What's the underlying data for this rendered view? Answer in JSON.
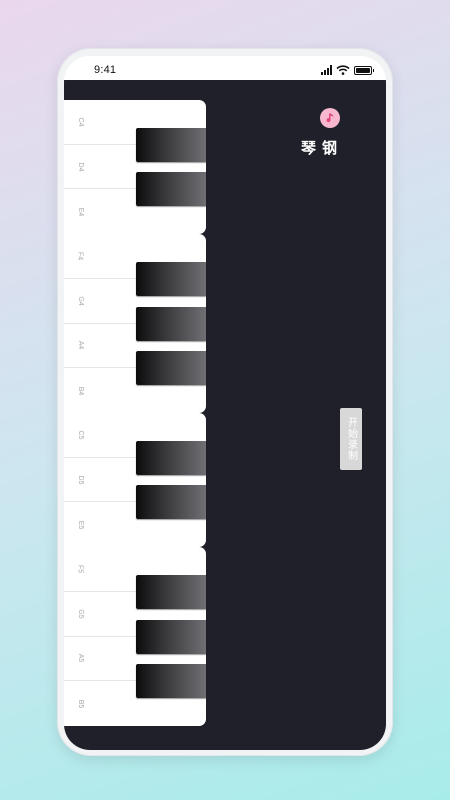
{
  "status_bar": {
    "time": "9:41"
  },
  "app": {
    "title": "钢琴",
    "record_button": "开始录制",
    "colors": {
      "background": "#1f2029",
      "logo": "#f7b8cf",
      "key_white": "#ffffff",
      "key_black": "#111111"
    },
    "logo_icon": "music-note-icon"
  },
  "piano": {
    "white_keys": [
      "C4",
      "D4",
      "E4",
      "F4",
      "G4",
      "A4",
      "B4",
      "C5",
      "D5",
      "E5",
      "F5",
      "G5",
      "A5",
      "B5"
    ],
    "black_keys": [
      "C#4",
      "D#4",
      "F#4",
      "G#4",
      "A#4",
      "C#5",
      "D#5",
      "F#5",
      "G#5",
      "A#5"
    ]
  }
}
